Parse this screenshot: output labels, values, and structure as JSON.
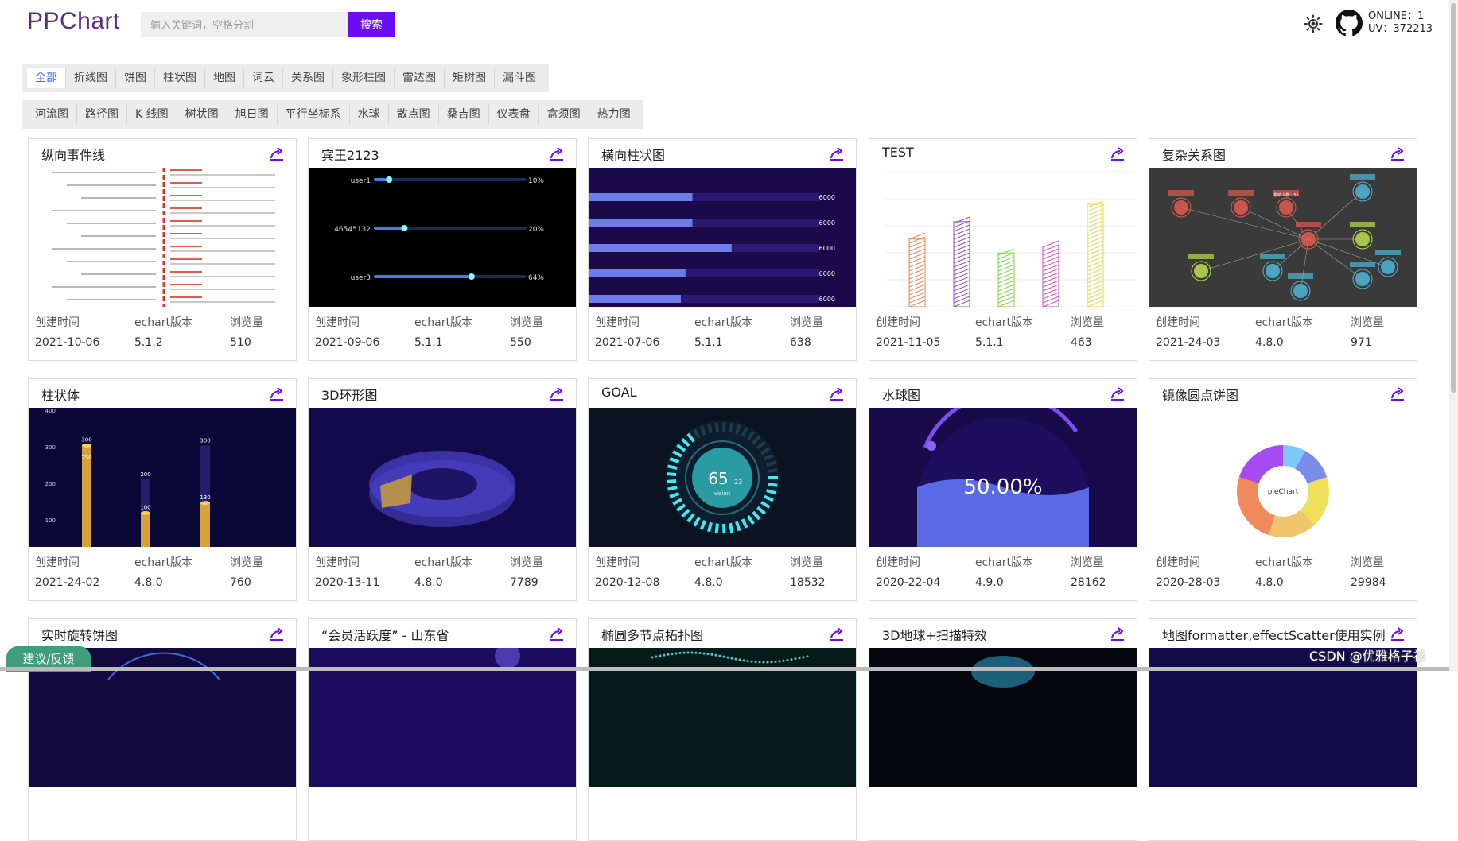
{
  "header": {
    "logo": "PPChart",
    "search_placeholder": "输入关键词，空格分割",
    "search_button": "搜索",
    "online": "ONLINE：1",
    "uv": "UV：372213"
  },
  "tabs_row1": [
    "全部",
    "折线图",
    "饼图",
    "柱状图",
    "地图",
    "词云",
    "关系图",
    "象形柱图",
    "雷达图",
    "矩树图",
    "漏斗图"
  ],
  "tabs_row2": [
    "河流图",
    "路径图",
    "K 线图",
    "树状图",
    "旭日图",
    "平行坐标系",
    "水球",
    "散点图",
    "桑吉图",
    "仪表盘",
    "盒须图",
    "热力图"
  ],
  "meta_labels": {
    "created": "创建时间",
    "version": "echart版本",
    "views": "浏览量"
  },
  "cards": [
    {
      "title": "纵向事件线",
      "created": "2021-10-06",
      "version": "5.1.2",
      "views": "510",
      "thumb": "timeline"
    },
    {
      "title": "宾王2123",
      "created": "2021-09-06",
      "version": "5.1.1",
      "views": "550",
      "thumb": "progress"
    },
    {
      "title": "横向柱状图",
      "created": "2021-07-06",
      "version": "5.1.1",
      "views": "638",
      "thumb": "hbar"
    },
    {
      "title": "TEST",
      "created": "2021-11-05",
      "version": "5.1.1",
      "views": "463",
      "thumb": "hatched"
    },
    {
      "title": "复杂关系图",
      "created": "2021-24-03",
      "version": "4.8.0",
      "views": "971",
      "thumb": "graph"
    },
    {
      "title": "柱状体",
      "created": "2021-24-02",
      "version": "4.8.0",
      "views": "760",
      "thumb": "cylinder"
    },
    {
      "title": "3D环形图",
      "created": "2020-13-11",
      "version": "4.8.0",
      "views": "7789",
      "thumb": "ring3d"
    },
    {
      "title": "GOAL",
      "created": "2020-12-08",
      "version": "4.8.0",
      "views": "18532",
      "thumb": "goal"
    },
    {
      "title": "水球图",
      "created": "2020-22-04",
      "version": "4.9.0",
      "views": "28162",
      "thumb": "liquid"
    },
    {
      "title": "镜像圆点饼图",
      "created": "2020-28-03",
      "version": "4.8.0",
      "views": "29984",
      "thumb": "donut"
    },
    {
      "title": "实时旋转饼图",
      "thumb": "dark1"
    },
    {
      "title": "“会员活跃度” - 山东省",
      "thumb": "dark2"
    },
    {
      "title": "椭圆多节点拓扑图",
      "thumb": "dark3"
    },
    {
      "title": "3D地球+扫描特效",
      "thumb": "dark4"
    },
    {
      "title": "地图formatter,effectScatter使用实例",
      "thumb": "dark5"
    }
  ],
  "thumb_text": {
    "progress_rows": [
      {
        "label": "user1",
        "pct": "10%",
        "fill": 0.1
      },
      {
        "label": "46545132",
        "pct": "20%",
        "fill": 0.2
      },
      {
        "label": "user3",
        "pct": "64%",
        "fill": 0.64
      }
    ],
    "hbar_value": "6000",
    "hbar_fill": [
      0.45,
      0.45,
      0.62,
      0.42,
      0.4
    ],
    "hatched_values": [
      2.95,
      3.45,
      2.55,
      2.75,
      3.95
    ],
    "cylinder_ticks": [
      "400",
      "300",
      "200",
      "100"
    ],
    "cylinder_values": [
      "250",
      "200",
      "100",
      "300",
      "130"
    ],
    "goal_number": "65",
    "goal_sub": "23",
    "goal_label": "vision",
    "liquid_text": "50.00%",
    "donut_center": "pieChart",
    "graph_node_label": "影响人数：55"
  },
  "feedback": "建议/反馈",
  "watermark": "CSDN @优雅格子衫",
  "colors": {
    "accent": "#6a0df5",
    "active_tab": "#2f6ff5",
    "logo": "#5b2a86"
  }
}
